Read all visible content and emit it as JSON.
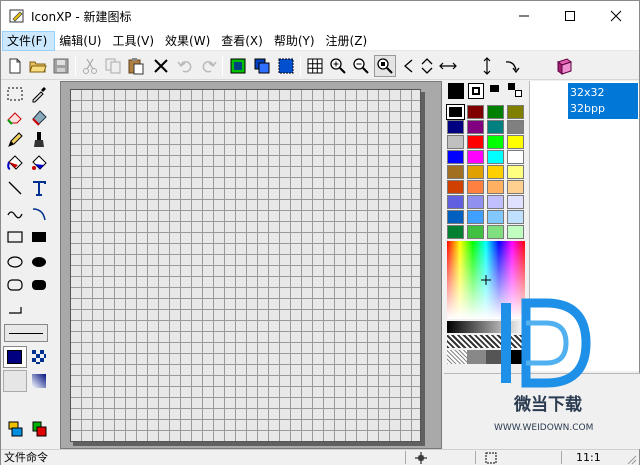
{
  "window": {
    "title": "IconXP - 新建图标"
  },
  "menu": [
    {
      "label": "文件(F)"
    },
    {
      "label": "编辑(U)"
    },
    {
      "label": "工具(V)"
    },
    {
      "label": "效果(W)"
    },
    {
      "label": "查看(X)"
    },
    {
      "label": "帮助(Y)"
    },
    {
      "label": "注册(Z)"
    }
  ],
  "toolbar_icons": [
    "new-file-icon",
    "open-folder-icon",
    "save-icon",
    "cut-icon",
    "copy-icon",
    "paste-icon",
    "delete-icon",
    "undo-icon",
    "redo-icon",
    "select-green-icon",
    "layers-icon",
    "select-blue-icon",
    "grid-icon",
    "zoom-in-icon",
    "zoom-out-icon",
    "zoom-fit-icon",
    "arrow-left-icon",
    "arrow-updown-icon",
    "arrow-leftright-icon",
    "arrow-vertical-icon",
    "rotate-icon",
    "book-icon"
  ],
  "format_list": [
    "32x32",
    "32bpp"
  ],
  "status": {
    "left": "文件命令",
    "zoom": "11:1"
  },
  "watermark": {
    "brand": "微当下载",
    "url": "WWW.WEIDOWN.COM"
  },
  "palette": {
    "colors": [
      "#000000",
      "#800000",
      "#008000",
      "#808000",
      "#000080",
      "#800080",
      "#008080",
      "#808080",
      "#c0c0c0",
      "#ff0000",
      "#00ff00",
      "#ffff00",
      "#0000ff",
      "#ff00ff",
      "#00ffff",
      "#ffffff",
      "#a07020",
      "#e0a000",
      "#ffd000",
      "#ffff80",
      "#d04000",
      "#ff8040",
      "#ffb060",
      "#ffd090",
      "#6060e0",
      "#9090f0",
      "#c0c0ff",
      "#e0e0ff",
      "#0060c0",
      "#40a0ff",
      "#80c8ff",
      "#c0e0ff",
      "#008030",
      "#40c040",
      "#80e080",
      "#c0ffc0"
    ],
    "accent": "#0078d7"
  }
}
